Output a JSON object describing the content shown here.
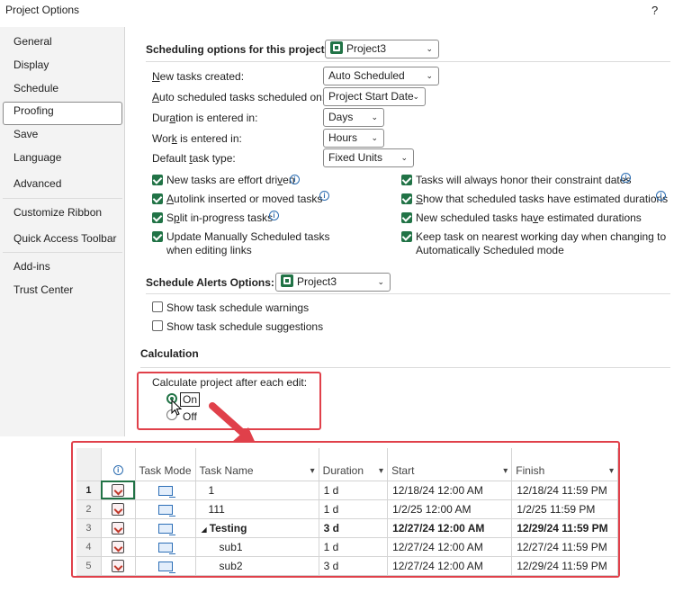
{
  "dialog": {
    "title": "Project Options",
    "help_glyph": "?"
  },
  "nav": {
    "items": [
      "General",
      "Display",
      "Schedule",
      "Proofing",
      "Save",
      "Language",
      "Advanced",
      "Customize Ribbon",
      "Quick Access Toolbar",
      "Add-ins",
      "Trust Center"
    ],
    "selected": "Schedule"
  },
  "scheduling": {
    "section_label": "Scheduling options for this project:",
    "project_select": "Project3",
    "rows": [
      {
        "label": "New tasks created:",
        "value": "Auto Scheduled"
      },
      {
        "label": "Auto scheduled tasks scheduled on:",
        "value": "Project Start Date"
      },
      {
        "label": "Duration is entered in:",
        "value": "Days"
      },
      {
        "label": "Work is entered in:",
        "value": "Hours"
      },
      {
        "label": "Default task type:",
        "value": "Fixed Units"
      }
    ],
    "checks_left": [
      {
        "label": "New tasks are effort driven",
        "checked": true
      },
      {
        "label": "Autolink inserted or moved tasks",
        "checked": true
      },
      {
        "label": "Split in-progress tasks",
        "checked": true
      },
      {
        "label": "Update Manually Scheduled tasks when editing links",
        "checked": true
      }
    ],
    "checks_right": [
      {
        "label": "Tasks will always honor their constraint dates",
        "checked": true
      },
      {
        "label": "Show that scheduled tasks have estimated durations",
        "checked": true
      },
      {
        "label": "New scheduled tasks have estimated durations",
        "checked": true
      },
      {
        "label": "Keep task on nearest working day when changing to Automatically Scheduled mode",
        "checked": true
      }
    ]
  },
  "alerts": {
    "section_label": "Schedule Alerts Options:",
    "project_select": "Project3",
    "checks": [
      {
        "label": "Show task schedule warnings",
        "checked": false
      },
      {
        "label": "Show task schedule suggestions",
        "checked": false
      }
    ]
  },
  "calculation": {
    "section_label": "Calculation",
    "prompt": "Calculate project after each edit:",
    "on_label": "On",
    "off_label": "Off",
    "selected": "On"
  },
  "gantt": {
    "columns": {
      "info": "i",
      "mode": "Task Mode",
      "name": "Task Name",
      "duration": "Duration",
      "start": "Start",
      "finish": "Finish"
    },
    "rows": [
      {
        "num": "1",
        "name": "1",
        "duration": "1 d",
        "start": "12/18/24 12:00 AM",
        "finish": "12/18/24 11:59 PM",
        "bold": false,
        "summary": false
      },
      {
        "num": "2",
        "name": "111",
        "duration": "1 d",
        "start": "1/2/25 12:00 AM",
        "finish": "1/2/25 11:59 PM",
        "bold": false,
        "summary": false
      },
      {
        "num": "3",
        "name": "Testing",
        "duration": "3 d",
        "start": "12/27/24 12:00 AM",
        "finish": "12/29/24 11:59 PM",
        "bold": true,
        "summary": true
      },
      {
        "num": "4",
        "name": "sub1",
        "duration": "1 d",
        "start": "12/27/24 12:00 AM",
        "finish": "12/27/24 11:59 PM",
        "bold": false,
        "summary": false
      },
      {
        "num": "5",
        "name": "sub2",
        "duration": "3 d",
        "start": "12/27/24 12:00 AM",
        "finish": "12/29/24 11:59 PM",
        "bold": false,
        "summary": false
      }
    ]
  },
  "colors": {
    "accent": "#217346",
    "highlight": "#e0404a",
    "link": "#2b6cb0"
  }
}
